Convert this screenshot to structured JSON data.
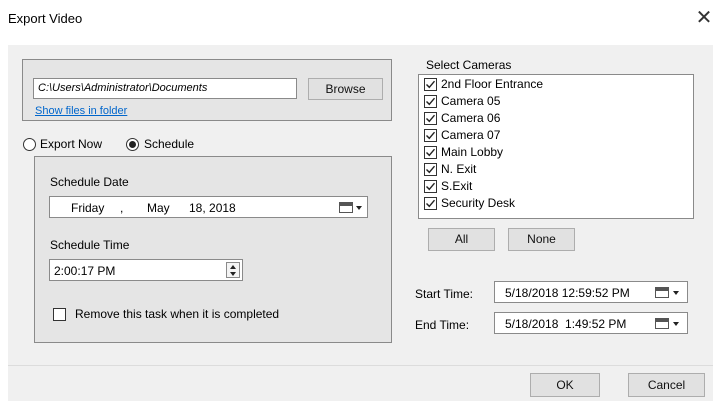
{
  "window": {
    "title": "Export Video",
    "close_glyph": "✕"
  },
  "path_box": {
    "path_value": "C:\\Users\\Administrator\\Documents",
    "browse_label": "Browse",
    "show_files_link": "Show files in folder"
  },
  "mode": {
    "export_now_label": "Export Now",
    "schedule_label": "Schedule",
    "selected": "Schedule"
  },
  "schedule": {
    "date_label": "Schedule Date",
    "date_weekday": "Friday",
    "date_sep": ",",
    "date_month": "May",
    "date_rest": "18, 2018",
    "time_label": "Schedule Time",
    "time_value": "2:00:17 PM",
    "remove_task_label": "Remove this task when it is completed",
    "remove_task_checked": false
  },
  "cameras": {
    "group_label": "Select Cameras",
    "items": [
      {
        "label": "2nd Floor Entrance",
        "checked": true
      },
      {
        "label": "Camera 05",
        "checked": true
      },
      {
        "label": "Camera 06",
        "checked": true
      },
      {
        "label": "Camera 07",
        "checked": true
      },
      {
        "label": "Main Lobby",
        "checked": true
      },
      {
        "label": "N. Exit",
        "checked": true
      },
      {
        "label": "S.Exit",
        "checked": true
      },
      {
        "label": "Security Desk",
        "checked": true
      }
    ],
    "all_label": "All",
    "none_label": "None"
  },
  "range": {
    "start_label": "Start Time:",
    "start_value": "5/18/2018 12:59:52 PM",
    "end_label": "End Time:",
    "end_value": "5/18/2018  1:49:52 PM"
  },
  "footer": {
    "ok_label": "OK",
    "cancel_label": "Cancel"
  },
  "icons": {
    "close": "close-icon",
    "calendar": "calendar-icon",
    "dropdown": "chevron-down-icon",
    "spinner": "spinner-icon",
    "check": "checkmark-icon"
  }
}
